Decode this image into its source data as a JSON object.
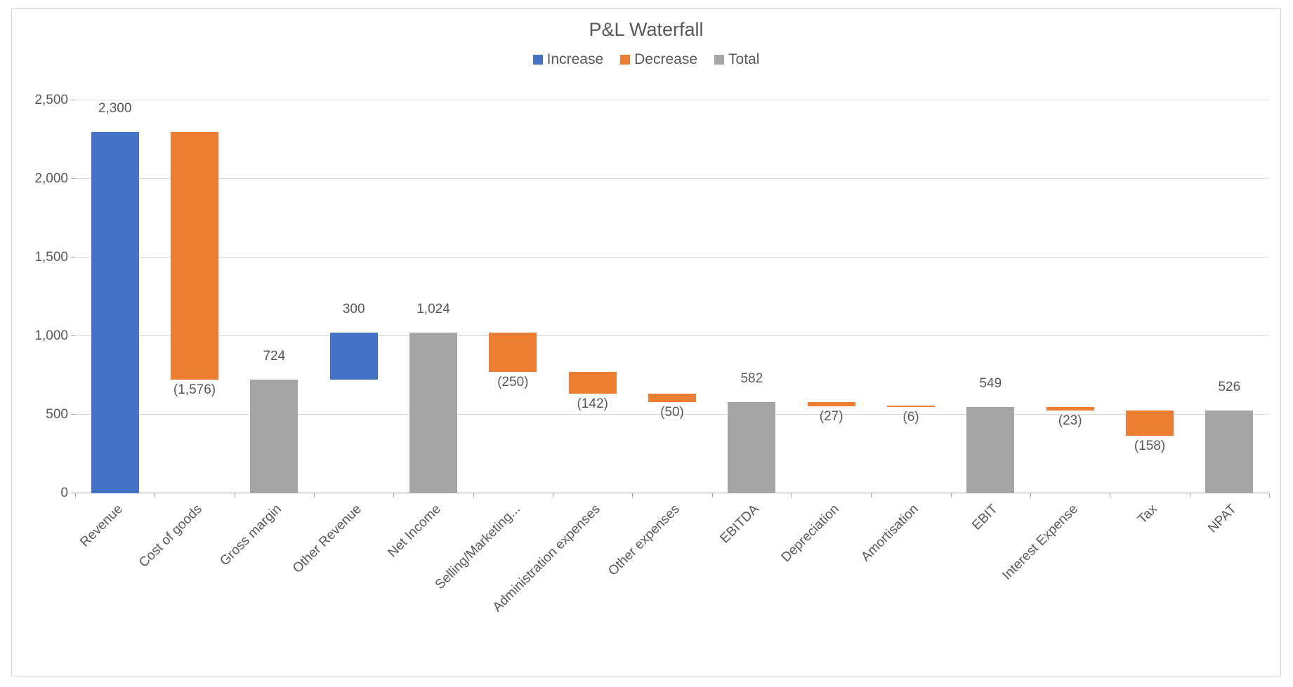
{
  "chart_data": {
    "type": "waterfall",
    "title": "P&L Waterfall",
    "ylim": [
      0,
      2500
    ],
    "y_ticks": [
      0,
      500,
      1000,
      1500,
      2000,
      2500
    ],
    "y_tick_labels": [
      "0",
      "500",
      "1,000",
      "1,500",
      "2,000",
      "2,500"
    ],
    "legend": [
      {
        "name": "Increase",
        "color": "#4472c4"
      },
      {
        "name": "Decrease",
        "color": "#ed7d31"
      },
      {
        "name": "Total",
        "color": "#a5a5a5"
      }
    ],
    "items": [
      {
        "category": "Revenue",
        "kind": "increase",
        "value": 2300,
        "label": "2,300",
        "start": 0,
        "end": 2300
      },
      {
        "category": "Cost of goods",
        "kind": "decrease",
        "value": -1576,
        "label": "(1,576)",
        "start": 2300,
        "end": 724
      },
      {
        "category": "Gross margin",
        "kind": "total",
        "value": 724,
        "label": "724",
        "start": 0,
        "end": 724
      },
      {
        "category": "Other Revenue",
        "kind": "increase",
        "value": 300,
        "label": "300",
        "start": 724,
        "end": 1024
      },
      {
        "category": "Net Income",
        "kind": "total",
        "value": 1024,
        "label": "1,024",
        "start": 0,
        "end": 1024
      },
      {
        "category": "Selling/Marketing...",
        "kind": "decrease",
        "value": -250,
        "label": "(250)",
        "start": 1024,
        "end": 774
      },
      {
        "category": "Administration expenses",
        "kind": "decrease",
        "value": -142,
        "label": "(142)",
        "start": 774,
        "end": 632
      },
      {
        "category": "Other expenses",
        "kind": "decrease",
        "value": -50,
        "label": "(50)",
        "start": 632,
        "end": 582
      },
      {
        "category": "EBITDA",
        "kind": "total",
        "value": 582,
        "label": "582",
        "start": 0,
        "end": 582
      },
      {
        "category": "Depreciation",
        "kind": "decrease",
        "value": -27,
        "label": "(27)",
        "start": 582,
        "end": 555
      },
      {
        "category": "Amortisation",
        "kind": "decrease",
        "value": -6,
        "label": "(6)",
        "start": 555,
        "end": 549
      },
      {
        "category": "EBIT",
        "kind": "total",
        "value": 549,
        "label": "549",
        "start": 0,
        "end": 549
      },
      {
        "category": "Interest Expense",
        "kind": "decrease",
        "value": -23,
        "label": "(23)",
        "start": 549,
        "end": 526
      },
      {
        "category": "Tax",
        "kind": "decrease",
        "value": -158,
        "label": "(158)",
        "start": 526,
        "end": 368
      },
      {
        "category": "NPAT",
        "kind": "total",
        "value": 526,
        "label": "526",
        "start": 0,
        "end": 526
      }
    ]
  }
}
